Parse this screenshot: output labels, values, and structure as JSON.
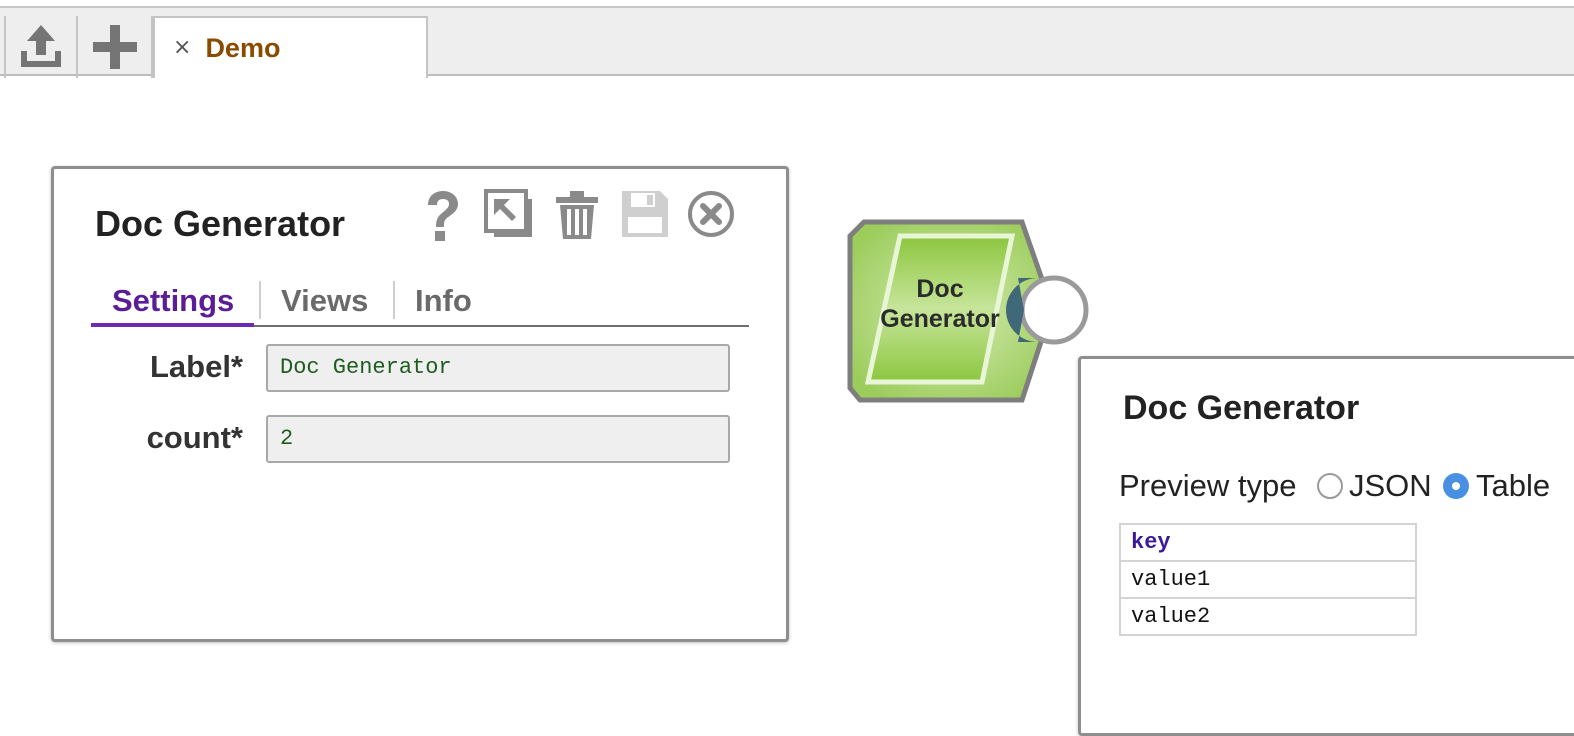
{
  "tabbar": {
    "upload_icon": "upload-icon",
    "add_icon": "plus-icon",
    "tab": {
      "close_glyph": "×",
      "label": "Demo"
    }
  },
  "settings_panel": {
    "title": "Doc Generator",
    "toolbar_icons": [
      "help-icon",
      "expand-icon",
      "trash-icon",
      "save-icon",
      "close-icon"
    ],
    "tabs": [
      {
        "label": "Settings",
        "active": true
      },
      {
        "label": "Views",
        "active": false
      },
      {
        "label": "Info",
        "active": false
      }
    ],
    "fields": [
      {
        "label": "Label*",
        "value": "Doc Generator"
      },
      {
        "label": "count*",
        "value": "2"
      }
    ]
  },
  "snap": {
    "line1": "Doc",
    "line2": "Generator",
    "output_icon": "document-icon"
  },
  "preview": {
    "title": "Doc Generator",
    "type_label": "Preview type",
    "options": [
      {
        "label": "JSON",
        "checked": false
      },
      {
        "label": "Table",
        "checked": true
      }
    ],
    "table": {
      "header": "key",
      "rows": [
        "value1",
        "value2"
      ]
    }
  },
  "colors": {
    "tab_text": "#8a4a00",
    "active_tab": "#5a1d96",
    "radio_checked": "#4a90e2",
    "snap_green": "#8cc63f",
    "snap_port": "#3f6878"
  }
}
